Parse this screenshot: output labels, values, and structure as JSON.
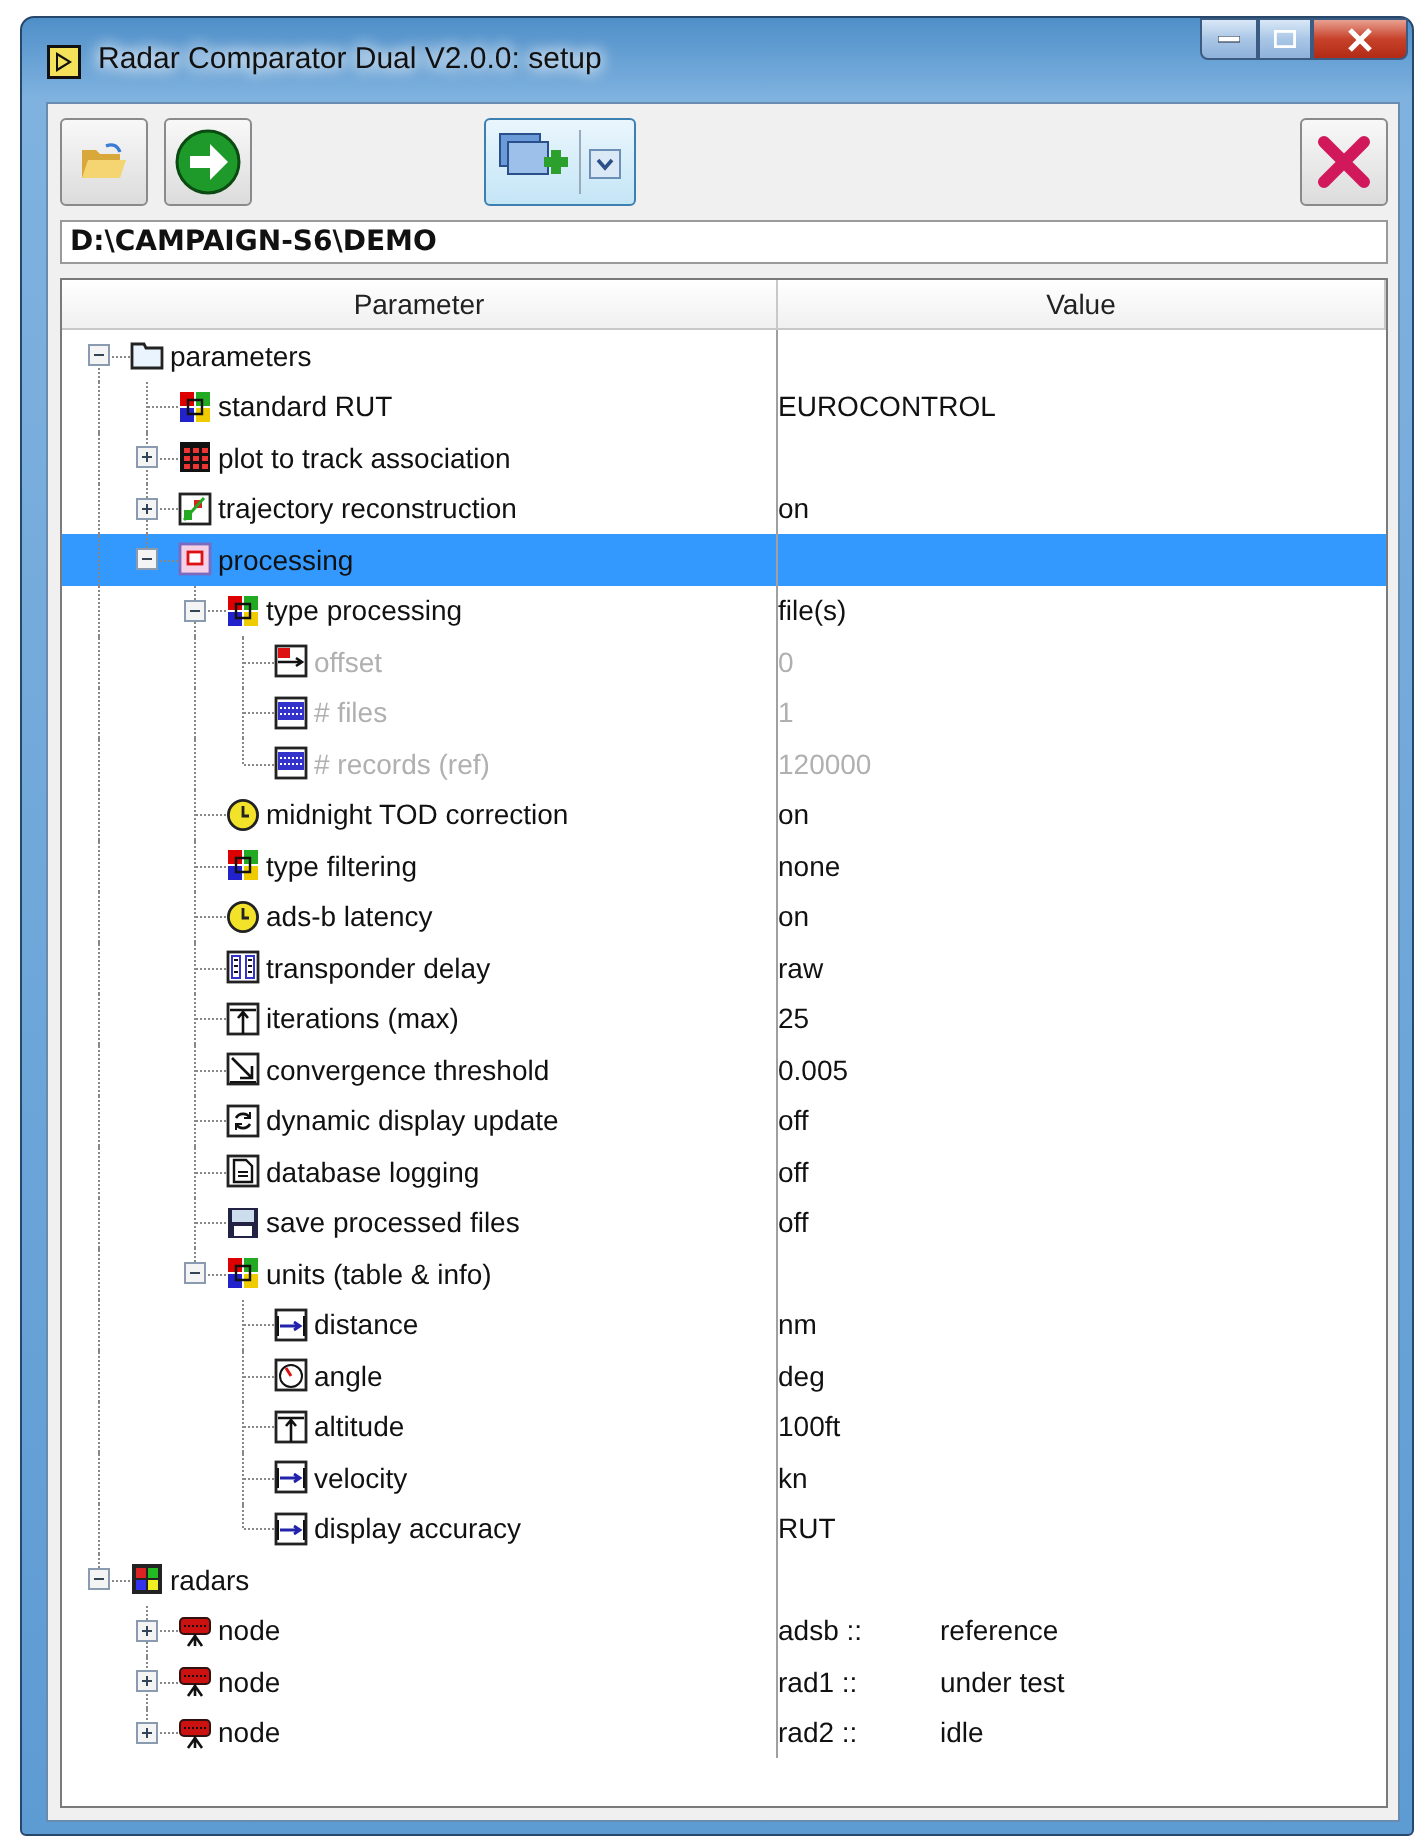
{
  "window": {
    "title": "Radar Comparator Dual V2.0.0: setup"
  },
  "path": "D:\\CAMPAIGN-S6\\DEMO",
  "table": {
    "columns": [
      "Parameter",
      "Value"
    ],
    "tree": [
      {
        "label": "parameters",
        "kind": "folder",
        "expanded": true,
        "selected": false,
        "children": [
          {
            "label": "standard RUT",
            "kind": "enum",
            "value": "EUROCONTROL",
            "selected": false
          },
          {
            "label": "plot to track association",
            "kind": "table",
            "expanded": false,
            "selected": false
          },
          {
            "label": "trajectory reconstruction",
            "kind": "graph",
            "expanded": false,
            "value": "on",
            "selected": false
          },
          {
            "label": "processing",
            "kind": "cluster",
            "expanded": true,
            "selected": true,
            "children": [
              {
                "label": "type processing",
                "kind": "enum",
                "expanded": true,
                "value": "file(s)",
                "selected": false,
                "children": [
                  {
                    "label": "offset",
                    "kind": "offset",
                    "value": "0",
                    "disabled": true,
                    "selected": false
                  },
                  {
                    "label": "# files",
                    "kind": "count",
                    "value": "1",
                    "disabled": true,
                    "selected": false
                  },
                  {
                    "label": "# records (ref)",
                    "kind": "count",
                    "value": "120000",
                    "disabled": true,
                    "selected": false
                  }
                ]
              },
              {
                "label": "midnight TOD correction",
                "kind": "clock",
                "value": "on",
                "selected": false
              },
              {
                "label": "type filtering",
                "kind": "enum",
                "value": "none",
                "selected": false
              },
              {
                "label": "ads-b latency",
                "kind": "clock",
                "value": "on",
                "selected": false
              },
              {
                "label": "transponder delay",
                "kind": "bars",
                "value": "raw",
                "selected": false
              },
              {
                "label": "iterations (max)",
                "kind": "up",
                "value": "25",
                "selected": false
              },
              {
                "label": "convergence threshold",
                "kind": "slope",
                "value": "0.005",
                "selected": false
              },
              {
                "label": "dynamic display update",
                "kind": "refresh",
                "value": "off",
                "selected": false
              },
              {
                "label": "database logging",
                "kind": "doc",
                "value": "off",
                "selected": false
              },
              {
                "label": "save processed files",
                "kind": "disk",
                "value": "off",
                "selected": false
              },
              {
                "label": "units (table & info)",
                "kind": "enum",
                "expanded": true,
                "selected": false,
                "children": [
                  {
                    "label": "distance",
                    "kind": "unit",
                    "value": "nm",
                    "selected": false
                  },
                  {
                    "label": "angle",
                    "kind": "gauge",
                    "value": "deg",
                    "selected": false
                  },
                  {
                    "label": "altitude",
                    "kind": "up",
                    "value": "100ft",
                    "selected": false
                  },
                  {
                    "label": "velocity",
                    "kind": "unit",
                    "value": "kn",
                    "selected": false
                  },
                  {
                    "label": "display accuracy",
                    "kind": "unit",
                    "value": "RUT",
                    "selected": false
                  }
                ]
              }
            ]
          }
        ]
      },
      {
        "label": "radars",
        "kind": "grid",
        "expanded": true,
        "selected": false,
        "children": [
          {
            "label": "node",
            "kind": "radar",
            "expanded": false,
            "value": "adsb ::",
            "status": "reference",
            "selected": false
          },
          {
            "label": "node",
            "kind": "radar",
            "expanded": false,
            "value": "rad1 ::",
            "status": "under test",
            "selected": false
          },
          {
            "label": "node",
            "kind": "radar",
            "expanded": false,
            "value": "rad2 ::",
            "status": "idle",
            "selected": false
          }
        ]
      }
    ]
  }
}
